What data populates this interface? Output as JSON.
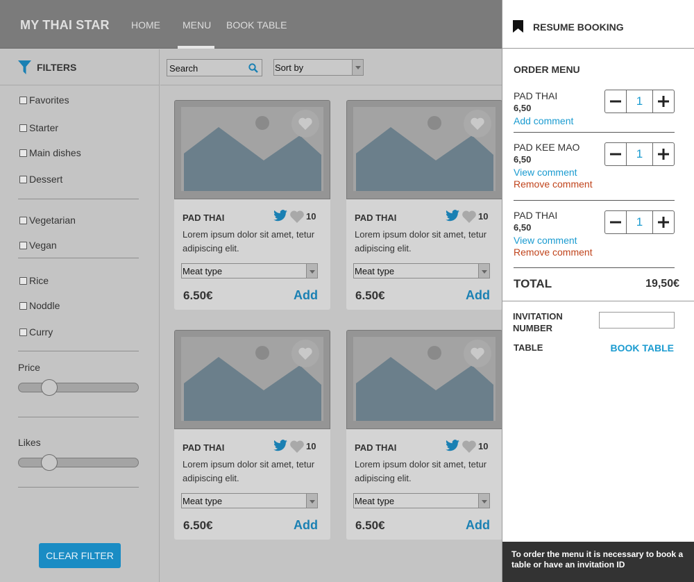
{
  "brand": "MY THAI STAR",
  "nav": {
    "home": "HOME",
    "menu": "MENU",
    "book_table": "BOOK TABLE"
  },
  "filters": {
    "title": "FILTERS",
    "groups": [
      [
        "Favorites",
        "Starter",
        "Main dishes",
        "Dessert"
      ],
      [
        "Vegetarian",
        "Vegan"
      ],
      [
        "Rice",
        "Noddle",
        "Curry"
      ]
    ],
    "price_label": "Price",
    "price_value": 0.22,
    "likes_label": "Likes",
    "likes_value": 0.22,
    "clear_label": "CLEAR FILTER"
  },
  "toolbar": {
    "search_placeholder": "Search",
    "sort_label": "Sort by"
  },
  "cards": [
    {
      "title": "PAD THAI",
      "likes": "10",
      "description": "Lorem ipsum dolor sit amet, tetur adipiscing elit.",
      "meat_type": "Meat type",
      "price": "6.50€",
      "add_label": "Add"
    },
    {
      "title": "PAD THAI",
      "likes": "10",
      "description": "Lorem ipsum dolor sit amet, tetur adipiscing elit.",
      "meat_type": "Meat type",
      "price": "6.50€",
      "add_label": "Add"
    },
    {
      "title": "PAD THAI",
      "likes": "10",
      "description": "Lorem ipsum dolor sit amet, tetur adipiscing elit.",
      "meat_type": "Meat type",
      "price": "6.50€",
      "add_label": "Add"
    },
    {
      "title": "PAD THAI",
      "likes": "10",
      "description": "Lorem ipsum dolor sit amet, tetur adipiscing elit.",
      "meat_type": "Meat type",
      "price": "6.50€",
      "add_label": "Add"
    }
  ],
  "booking": {
    "title": "RESUME BOOKING",
    "order_title": "ORDER MENU",
    "items": [
      {
        "name": "PAD THAI",
        "price": "6,50",
        "qty": "1",
        "link": "Add comment"
      },
      {
        "name": "PAD KEE MAO",
        "price": "6,50",
        "qty": "1",
        "link": "View comment",
        "remove": "Remove comment"
      },
      {
        "name": "PAD THAI",
        "price": "6,50",
        "qty": "1",
        "link": "View comment",
        "remove": "Remove comment"
      }
    ],
    "total_label": "TOTAL",
    "total_value": "19,50€",
    "invitation_label": "INVITATION NUMBER",
    "table_label": "TABLE",
    "book_table_label": "BOOK TABLE",
    "notice": "To order the menu it is necessary to book a table or have an invitation ID"
  },
  "colors": {
    "accent": "#1a9bd0",
    "remove": "#c0441c",
    "twitter": "#1a80b3"
  },
  "icons": [
    "filter-icon",
    "search-icon",
    "heart-icon",
    "twitter-icon",
    "bookmark-icon",
    "minus-icon",
    "plus-icon"
  ]
}
